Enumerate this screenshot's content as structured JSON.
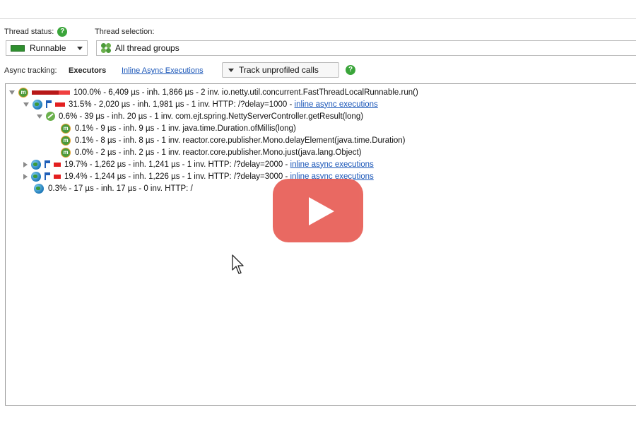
{
  "top_bar": {
    "thread_status_label": "Thread status:",
    "thread_selection_label": "Thread selection:",
    "thread_status_value": "Runnable",
    "thread_selection_value": "All thread groups",
    "help_glyph": "?"
  },
  "async_bar": {
    "label": "Async tracking:",
    "mode": "Executors",
    "inline_link": "Inline Async Executions",
    "track_button": "Track unprofiled calls"
  },
  "tree": {
    "rows": [
      {
        "text": "100.0% - 6,409 µs - inh. 1,866 µs - 2 inv. io.netty.util.concurrent.FastThreadLocalRunnable.run()",
        "link": ""
      },
      {
        "text": "31.5% - 2,020 µs - inh. 1,981 µs - 1 inv. HTTP: /?delay=1000 - ",
        "link": "inline async executions"
      },
      {
        "text": "0.6% - 39 µs - inh. 20 µs - 1 inv. com.ejt.spring.NettyServerController.getResult(long)",
        "link": ""
      },
      {
        "text": "0.1% - 9 µs - inh. 9 µs - 1 inv. java.time.Duration.ofMillis(long)",
        "link": ""
      },
      {
        "text": "0.1% - 8 µs - inh. 8 µs - 1 inv. reactor.core.publisher.Mono.delayElement(java.time.Duration)",
        "link": ""
      },
      {
        "text": "0.0% - 2 µs - inh. 2 µs - 1 inv. reactor.core.publisher.Mono.just(java.lang.Object)",
        "link": ""
      },
      {
        "text": "19.7% - 1,262 µs - inh. 1,241 µs - 1 inv. HTTP: /?delay=2000 - ",
        "link": "inline async executions"
      },
      {
        "text": "19.4% - 1,244 µs - inh. 1,226 µs - 1 inv. HTTP: /?delay=3000 - ",
        "link": "inline async executions"
      },
      {
        "text": "0.3% - 17 µs - inh. 17 µs - 0 inv. HTTP: /",
        "link": ""
      }
    ]
  },
  "icons": {
    "method": "method-icon",
    "globe": "http-request-icon",
    "spring": "spring-icon",
    "play": "play-icon",
    "cursor": "mouse-cursor-icon",
    "method_glyph": "m"
  },
  "colors": {
    "accent_red": "#e32020",
    "link_blue": "#1a56b8",
    "help_green": "#3aa53a",
    "play_overlay": "#e8625a"
  }
}
